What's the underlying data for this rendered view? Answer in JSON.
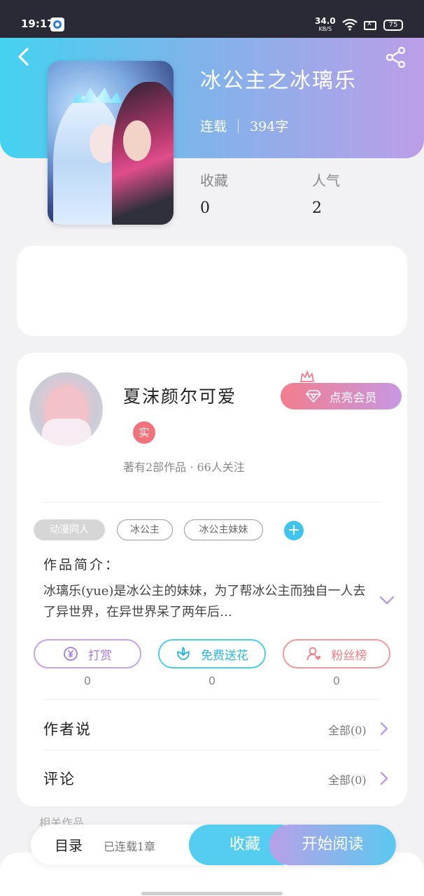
{
  "status_bar": {
    "time": "19:17",
    "net_speed": "34.0",
    "net_unit": "KB/S",
    "battery": "75"
  },
  "book": {
    "title": "冰公主之冰璃乐",
    "status": "连载",
    "word_count": "394字",
    "stats": [
      {
        "label": "收藏",
        "value": "0"
      },
      {
        "label": "人气",
        "value": "2"
      }
    ]
  },
  "author": {
    "name": "夏沫颜尔可爱",
    "badge": "实",
    "meta": "著有2部作品 · 66人关注",
    "vip_button": "点亮会员"
  },
  "tags": [
    "动漫同人",
    "冰公主",
    "冰公主妹妹"
  ],
  "intro": {
    "title": "作品简介：",
    "text": "冰璃乐(yue)是冰公主的妹妹，为了帮冰公主而独自一人去了异世界，在异世界呆了两年后…"
  },
  "actions": [
    {
      "label": "打赏",
      "count": "0",
      "icon": "yen-coin-icon"
    },
    {
      "label": "免费送花",
      "count": "0",
      "icon": "flower-icon"
    },
    {
      "label": "粉丝榜",
      "count": "0",
      "icon": "fans-icon"
    }
  ],
  "rows": [
    {
      "title": "作者说",
      "right": "全部(0)"
    },
    {
      "title": "评论",
      "right": "全部(0)"
    }
  ],
  "peek_text": "相关作品",
  "bottom_bar": {
    "toc": "目录",
    "updated": "已连载1章",
    "favorite": "收藏",
    "read": "开始阅读"
  },
  "colors": {
    "header_start": "#44d2f0",
    "header_end": "#bc9ee8",
    "vip_start": "#f27d8d",
    "vip_end": "#c798e3",
    "tip": "#a57bdc",
    "flower": "#27b8e0",
    "fans": "#ef7d81"
  }
}
